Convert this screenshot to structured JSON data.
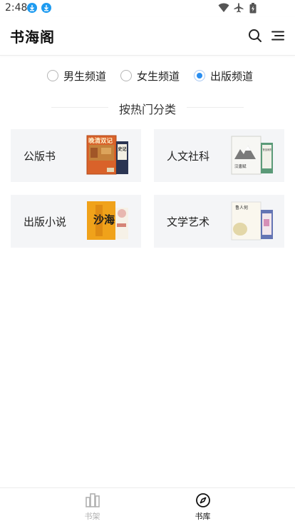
{
  "status_bar": {
    "time": "2:48"
  },
  "header": {
    "title": "书海阁"
  },
  "channels": [
    {
      "label": "男生频道",
      "selected": false
    },
    {
      "label": "女生频道",
      "selected": false
    },
    {
      "label": "出版频道",
      "selected": true
    }
  ],
  "section": {
    "title": "按热门分类"
  },
  "categories": [
    {
      "label": "公版书"
    },
    {
      "label": "人文社科"
    },
    {
      "label": "出版小说"
    },
    {
      "label": "文学艺术"
    }
  ],
  "cover_text": {
    "gongban_a": "晚清双记",
    "gongban_b": "史记",
    "renwen_a": "汉唐赋",
    "renwen_b": "鲁迅河东",
    "chuban_a": "沙海",
    "wenxue_a": "鲁人何"
  },
  "bottom_nav": [
    {
      "label": "书架",
      "active": false
    },
    {
      "label": "书库",
      "active": true
    }
  ],
  "colors": {
    "accent": "#2a8ef0",
    "download_badge": "#1e9bf0",
    "card_bg": "#f4f5f7",
    "nav_active": "#111111",
    "nav_inactive": "#b0b0b0"
  }
}
